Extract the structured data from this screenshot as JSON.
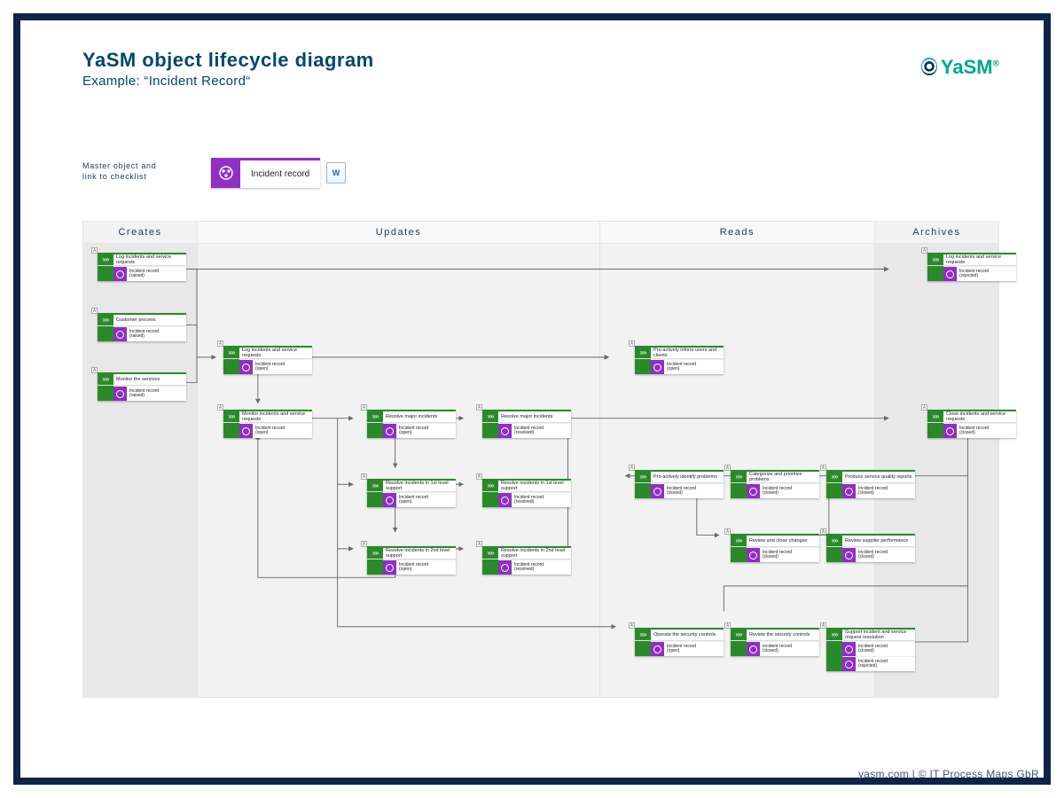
{
  "header": {
    "title": "YaSM object lifecycle diagram",
    "subtitle": "Example: “Incident Record“",
    "brand": "YaSM",
    "brand_tm": "®"
  },
  "footer": "yasm.com  |  © IT Process Maps GbR",
  "legend": {
    "line1": "Master object and",
    "line2": "link to checklist"
  },
  "master": {
    "label": "Incident record"
  },
  "lanes": {
    "creates": "Creates",
    "updates": "Updates",
    "reads": "Reads",
    "archives": "Archives"
  },
  "nodes": {
    "c1": {
      "title": "Log incidents and service requests",
      "recs": [
        {
          "n": "Incident record",
          "s": "(raised)"
        }
      ]
    },
    "c2": {
      "title": "Customer process",
      "recs": [
        {
          "n": "Incident record",
          "s": "(raised)"
        }
      ]
    },
    "c3": {
      "title": "Monitor the services",
      "recs": [
        {
          "n": "Incident record",
          "s": "(raised)"
        }
      ]
    },
    "u1": {
      "title": "Log incidents and service requests",
      "recs": [
        {
          "n": "Incident record",
          "s": "(open)"
        }
      ]
    },
    "u2": {
      "title": "Monitor incidents and service requests",
      "recs": [
        {
          "n": "Incident record",
          "s": "(open)"
        }
      ]
    },
    "u3a": {
      "title": "Resolve major incidents",
      "recs": [
        {
          "n": "Incident record",
          "s": "(open)"
        }
      ]
    },
    "u3b": {
      "title": "Resolve major incidents",
      "recs": [
        {
          "n": "Incident record",
          "s": "(resolved)"
        }
      ]
    },
    "u4a": {
      "title": "Resolve incidents in 1st level support",
      "recs": [
        {
          "n": "Incident record",
          "s": "(open)"
        }
      ]
    },
    "u4b": {
      "title": "Resolve incidents in 1st level support",
      "recs": [
        {
          "n": "Incident record",
          "s": "(resolved)"
        }
      ]
    },
    "u5a": {
      "title": "Resolve incidents in 2nd level support",
      "recs": [
        {
          "n": "Incident record",
          "s": "(open)"
        }
      ]
    },
    "u5b": {
      "title": "Resolve incidents in 2nd level support",
      "recs": [
        {
          "n": "Incident record",
          "s": "(resolved)"
        }
      ]
    },
    "r1": {
      "title": "Pro-actively inform users and clients",
      "recs": [
        {
          "n": "Incident record",
          "s": "(open)"
        }
      ]
    },
    "r2a": {
      "title": "Pro-actively identify problems",
      "recs": [
        {
          "n": "Incident record",
          "s": "(closed)"
        }
      ]
    },
    "r2b": {
      "title": "Categorize and prioritize problems",
      "recs": [
        {
          "n": "Incident record",
          "s": "(closed)"
        }
      ]
    },
    "r2c": {
      "title": "Produce service quality reports",
      "recs": [
        {
          "n": "Incident record",
          "s": "(closed)"
        }
      ]
    },
    "r3a": {
      "title": "Review and close changes",
      "recs": [
        {
          "n": "Incident record",
          "s": "(closed)"
        }
      ]
    },
    "r3b": {
      "title": "Review supplier performance",
      "recs": [
        {
          "n": "Incident record",
          "s": "(closed)"
        }
      ]
    },
    "r4a": {
      "title": "Operate the security controls",
      "recs": [
        {
          "n": "Incident record",
          "s": "(open)"
        }
      ]
    },
    "r4b": {
      "title": "Review the security controls",
      "recs": [
        {
          "n": "Incident record",
          "s": "(closed)"
        }
      ]
    },
    "r4c": {
      "title": "Support incident and service request resolution",
      "recs": [
        {
          "n": "Incident record",
          "s": "(closed)"
        },
        {
          "n": "Incident record",
          "s": "(rejected)"
        }
      ]
    },
    "a1": {
      "title": "Log incidents and service requests",
      "recs": [
        {
          "n": "Incident record",
          "s": "(rejected)"
        }
      ]
    },
    "a2": {
      "title": "Close incidents and service requests",
      "recs": [
        {
          "n": "Incident record",
          "s": "(closed)"
        }
      ]
    }
  }
}
